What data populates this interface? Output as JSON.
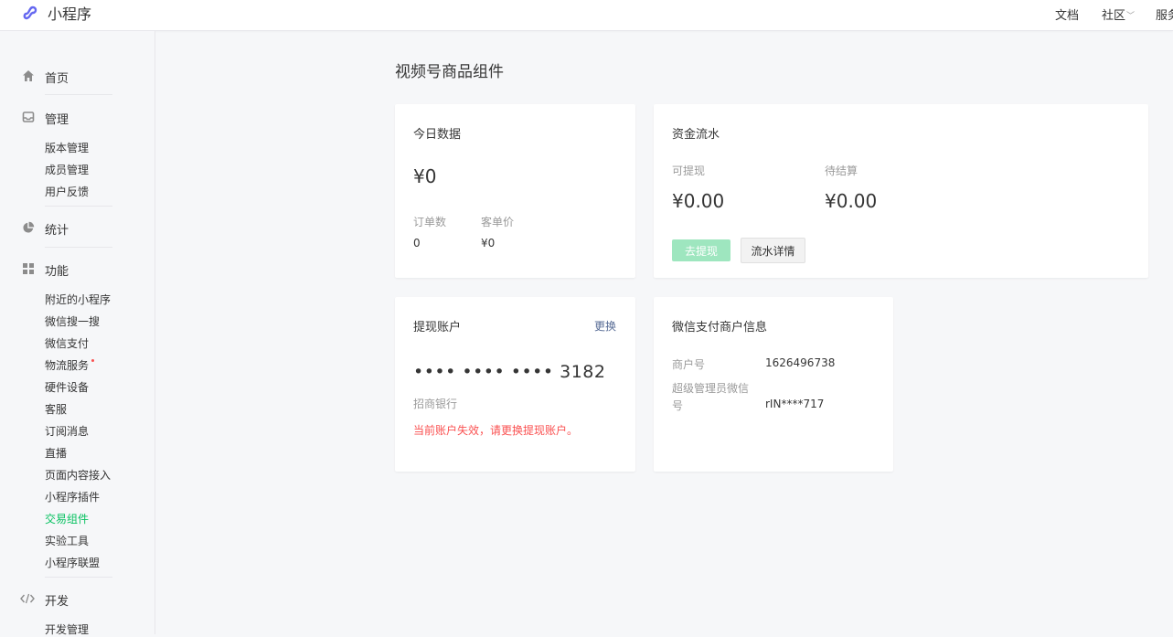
{
  "topbar": {
    "brand": "小程序",
    "links": {
      "docs": "文档",
      "community": "社区",
      "service": "服务"
    }
  },
  "sidebar": {
    "home": "首页",
    "manage": {
      "label": "管理",
      "items": [
        "版本管理",
        "成员管理",
        "用户反馈"
      ]
    },
    "stats": "统计",
    "features": {
      "label": "功能",
      "items": [
        "附近的小程序",
        "微信搜一搜",
        "微信支付",
        "物流服务",
        "硬件设备",
        "客服",
        "订阅消息",
        "直播",
        "页面内容接入",
        "小程序插件",
        "交易组件",
        "实验工具",
        "小程序联盟"
      ],
      "active": "交易组件"
    },
    "dev": {
      "label": "开发",
      "items": [
        "开发管理"
      ]
    }
  },
  "main": {
    "title": "视频号商品组件",
    "today": {
      "title": "今日数据",
      "amount": "¥0",
      "orders_label": "订单数",
      "orders_value": "0",
      "aov_label": "客单价",
      "aov_value": "¥0"
    },
    "funds": {
      "title": "资金流水",
      "withdrawable_label": "可提现",
      "withdrawable_value": "¥0.00",
      "pending_label": "待结算",
      "pending_value": "¥0.00",
      "withdraw_button": "去提现",
      "detail_button": "流水详情"
    },
    "account": {
      "title": "提现账户",
      "change_link": "更换",
      "masked_number": "•••• •••• •••• 3182",
      "bank": "招商银行",
      "warning": "当前账户失效，请更换提现账户。"
    },
    "merchant": {
      "title": "微信支付商户信息",
      "id_label": "商户号",
      "id_value": "1626496738",
      "admin_label_line1": "超级管理员微信",
      "admin_label_line2": "号",
      "admin_value": "rIN****717"
    }
  },
  "colors": {
    "accent": "#07c160",
    "accent_disabled": "#9ee6bf",
    "link": "#576b95",
    "danger": "#fa5151",
    "logo": "#6467f0"
  },
  "icons": {
    "logo": "miniprogram-logo-icon",
    "home": "home-icon",
    "manage": "inbox-icon",
    "stats": "pie-chart-icon",
    "features": "grid-icon",
    "dev": "code-icon"
  }
}
